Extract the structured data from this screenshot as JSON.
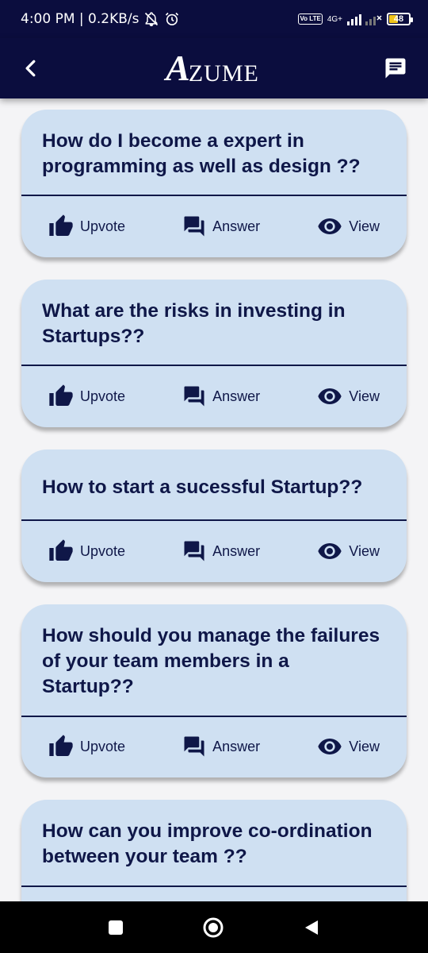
{
  "status_bar": {
    "time_speed": "4:00 PM | 0.2KB/s",
    "network_label": "4G+",
    "volte_label": "Vo LTE",
    "battery_level": "48"
  },
  "app_bar": {
    "logo_initial": "A",
    "logo_rest": "ZUME",
    "back_icon": "arrow-back-icon",
    "chat_icon": "chat-bubble-icon"
  },
  "actions": {
    "upvote": "Upvote",
    "answer": "Answer",
    "view": "View"
  },
  "questions": [
    {
      "text": "How do I become a expert in programming as well as design ??"
    },
    {
      "text": "What are the risks in investing in Startups??"
    },
    {
      "text": "How to start a sucessful Startup??"
    },
    {
      "text": "How should you manage the failures of your team members in a Startup??"
    },
    {
      "text": "How can you improve co-ordination between your team  ??"
    }
  ],
  "colors": {
    "app_bar": "#0b0d3e",
    "card": "#cfe0f2",
    "text": "#0f1748",
    "background": "#f4f4f6"
  }
}
